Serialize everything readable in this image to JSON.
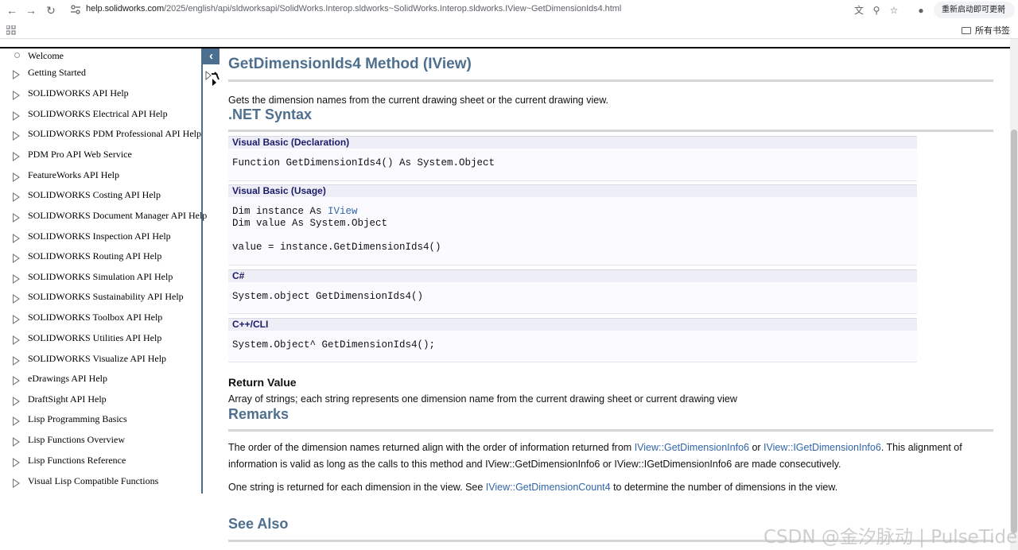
{
  "browser": {
    "url_host": "help.solidworks.com",
    "url_path": "/2025/english/api/sldworksapi/SolidWorks.Interop.sldworks~SolidWorks.Interop.sldworks.IView~GetDimensionIds4.html",
    "update_button": "重新启动即可更新",
    "all_bookmarks": "所有书签"
  },
  "toc": {
    "items": [
      {
        "label": "Welcome",
        "kind": "leaf"
      },
      {
        "label": "Getting Started",
        "kind": "folder"
      },
      {
        "label": "SOLIDWORKS API Help",
        "kind": "folder"
      },
      {
        "label": "SOLIDWORKS Electrical API Help",
        "kind": "folder"
      },
      {
        "label": "SOLIDWORKS PDM Professional API Help",
        "kind": "folder"
      },
      {
        "label": "PDM Pro API Web Service",
        "kind": "folder"
      },
      {
        "label": "FeatureWorks API Help",
        "kind": "folder"
      },
      {
        "label": "SOLIDWORKS Costing API Help",
        "kind": "folder"
      },
      {
        "label": "SOLIDWORKS Document Manager API Help",
        "kind": "folder"
      },
      {
        "label": "SOLIDWORKS Inspection API Help",
        "kind": "folder"
      },
      {
        "label": "SOLIDWORKS Routing API Help",
        "kind": "folder"
      },
      {
        "label": "SOLIDWORKS Simulation API Help",
        "kind": "folder"
      },
      {
        "label": "SOLIDWORKS Sustainability API Help",
        "kind": "folder"
      },
      {
        "label": "SOLIDWORKS Toolbox API Help",
        "kind": "folder"
      },
      {
        "label": "SOLIDWORKS Utilities API Help",
        "kind": "folder"
      },
      {
        "label": "SOLIDWORKS Visualize API Help",
        "kind": "folder"
      },
      {
        "label": "eDrawings API Help",
        "kind": "folder"
      },
      {
        "label": "DraftSight API Help",
        "kind": "folder"
      },
      {
        "label": "Lisp Programming Basics",
        "kind": "folder"
      },
      {
        "label": "Lisp Functions Overview",
        "kind": "folder"
      },
      {
        "label": "Lisp Functions Reference",
        "kind": "folder"
      },
      {
        "label": "Visual Lisp Compatible Functions",
        "kind": "folder"
      }
    ]
  },
  "content": {
    "title": "GetDimensionIds4 Method (IView)",
    "summary": "Gets the dimension names from the current drawing sheet or the current drawing view.",
    "syntax_heading": ".NET Syntax",
    "vb_decl_head": "Visual Basic (Declaration)",
    "vb_decl_code": "Function GetDimensionIds4() As System.Object",
    "vb_usage_head": "Visual Basic (Usage)",
    "vb_usage_l1a": "Dim instance As ",
    "vb_usage_l1link": "IView",
    "vb_usage_l2": "Dim value As System.Object",
    "vb_usage_l3": "value = instance.GetDimensionIds4()",
    "cs_head": "C#",
    "cs_code": "System.object GetDimensionIds4()",
    "cpp_head": "C++/CLI",
    "cpp_code": "System.Object^ GetDimensionIds4();",
    "return_heading": "Return Value",
    "return_text": "Array of strings; each string represents one dimension name from the current drawing sheet or current drawing view",
    "remarks_heading": "Remarks",
    "r1_a": "The order of the dimension names returned align with the order of information returned from ",
    "r1_link1": "IView::GetDimensionInfo6",
    "r1_b": " or ",
    "r1_link2": "IView::IGetDimensionInfo6",
    "r1_c": ". This alignment of",
    "r2": "information is valid as long as the calls to this method and IView::GetDimensionInfo6 or IView::IGetDimensionInfo6 are made consecutively.",
    "r3_a": "One string is returned for each dimension in the view. See ",
    "r3_link": "IView::GetDimensionCount4",
    "r3_b": " to determine the number of dimensions in the view.",
    "see_also_heading": "See Also"
  },
  "watermark": "CSDN @金汐脉动 | PulseTide"
}
